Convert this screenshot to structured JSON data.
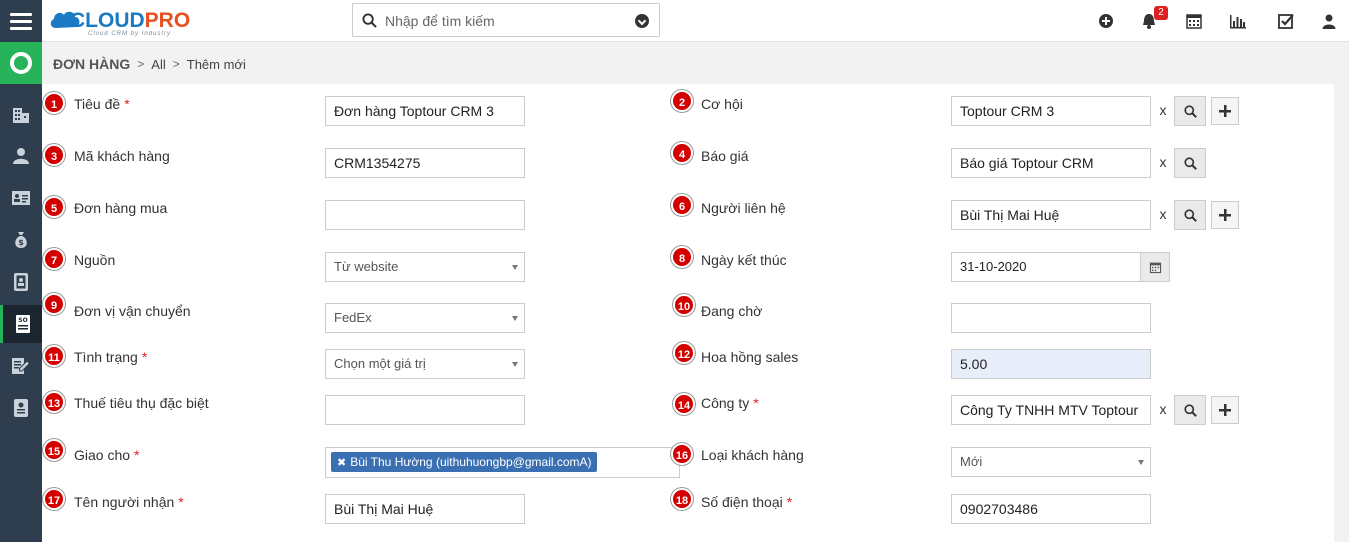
{
  "header": {
    "logo_text": "CLOUDPRO",
    "logo_tagline": "Cloud CRM by Industry",
    "search_placeholder": "Nhập để tìm kiếm",
    "notification_count": "2",
    "icons": [
      "add-circle-icon",
      "bell-icon",
      "calendar-icon",
      "bar-chart-icon",
      "checkbox-icon",
      "user-icon"
    ]
  },
  "sidebar": {
    "items": [
      "home-icon",
      "building-icon",
      "person-icon",
      "id-card-icon",
      "money-bag-icon",
      "contact-book-icon",
      "sales-order-icon",
      "edit-document-icon",
      "document-icon"
    ]
  },
  "breadcrumb": {
    "module": "ĐƠN HÀNG",
    "level1": "All",
    "level2": "Thêm mới"
  },
  "form": {
    "left": [
      {
        "num": "1",
        "label": "Tiêu đề",
        "required": "*",
        "value": "Đơn hàng Toptour CRM 3"
      },
      {
        "num": "3",
        "label": "Mã khách hàng",
        "required": "",
        "value": "CRM1354275"
      },
      {
        "num": "5",
        "label": "Đơn hàng mua",
        "required": "",
        "value": ""
      },
      {
        "num": "7",
        "label": "Nguồn",
        "required": "",
        "value": "Từ website"
      },
      {
        "num": "9",
        "label": "Đơn vị vận chuyển",
        "required": "",
        "value": "FedEx"
      },
      {
        "num": "11",
        "label": "Tình trạng",
        "required": "*",
        "value": "Chọn một giá trị"
      },
      {
        "num": "13",
        "label": "Thuế tiêu thụ đặc biệt",
        "required": "",
        "value": ""
      },
      {
        "num": "15",
        "label": "Giao cho",
        "required": "*",
        "value": "Bùi Thu Hường (uithuhuongbp@gmail.comA)"
      },
      {
        "num": "17",
        "label": "Tên người nhận",
        "required": "*",
        "value": "Bùi Thị Mai Huệ"
      }
    ],
    "right": [
      {
        "num": "2",
        "label": "Cơ hội",
        "required": "",
        "value": "Toptour CRM 3"
      },
      {
        "num": "4",
        "label": "Báo giá",
        "required": "",
        "value": "Báo giá Toptour CRM"
      },
      {
        "num": "6",
        "label": "Người liên hệ",
        "required": "",
        "value": "Bùi Thị Mai Huệ"
      },
      {
        "num": "8",
        "label": "Ngày kết thúc",
        "required": "",
        "value": "31-10-2020"
      },
      {
        "num": "10",
        "label": "Đang chờ",
        "required": "",
        "value": ""
      },
      {
        "num": "12",
        "label": "Hoa hồng sales",
        "required": "",
        "value": "5.00"
      },
      {
        "num": "14",
        "label": "Công ty",
        "required": "*",
        "value": "Công Ty TNHH MTV Toptour"
      },
      {
        "num": "16",
        "label": "Loại khách hàng",
        "required": "",
        "value": "Mới"
      },
      {
        "num": "18",
        "label": "Số điện thoại",
        "required": "*",
        "value": "0902703486"
      }
    ],
    "clear_label": "x"
  },
  "colors": {
    "sidebar": "#2e3e4e",
    "accent_green": "#27b35a",
    "marker_red": "#d40000",
    "tag_blue": "#3a70b2"
  }
}
